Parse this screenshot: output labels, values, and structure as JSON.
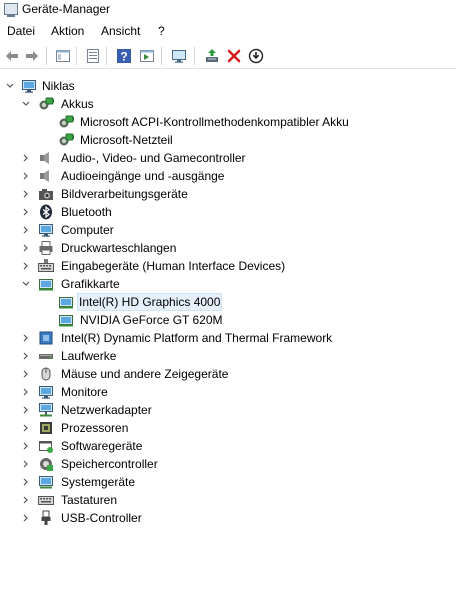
{
  "window": {
    "title": "Geräte-Manager",
    "icon": "device-manager-icon"
  },
  "menu": [
    "Datei",
    "Aktion",
    "Ansicht",
    "?"
  ],
  "toolbar": [
    {
      "name": "back-button",
      "icon": "arrow-left-icon"
    },
    {
      "name": "forward-button",
      "icon": "arrow-right-icon"
    },
    {
      "name": "show-hide-console-tree-button",
      "icon": "console-tree-icon"
    },
    {
      "name": "properties-button",
      "icon": "properties-icon"
    },
    {
      "name": "help-button",
      "icon": "help-icon"
    },
    {
      "name": "action-pane-button",
      "icon": "action-pane-icon"
    },
    {
      "name": "scan-hardware-button",
      "icon": "monitor-scan-icon"
    },
    {
      "name": "update-driver-button",
      "icon": "update-driver-icon"
    },
    {
      "name": "uninstall-device-button",
      "icon": "red-x-icon"
    },
    {
      "name": "disable-device-button",
      "icon": "down-arrow-circle-icon"
    }
  ],
  "tree": {
    "root": {
      "label": "Niklas",
      "icon": "computer-icon"
    },
    "nodes": [
      {
        "label": "Akkus",
        "icon": "battery-icon",
        "expanded": true,
        "children": [
          {
            "label": "Microsoft ACPI-Kontrollmethodenkompatibler Akku",
            "icon": "battery-icon"
          },
          {
            "label": "Microsoft-Netzteil",
            "icon": "battery-icon"
          }
        ]
      },
      {
        "label": "Audio-, Video- und Gamecontroller",
        "icon": "speaker-icon",
        "expanded": false
      },
      {
        "label": "Audioeingänge und -ausgänge",
        "icon": "speaker-icon",
        "expanded": false
      },
      {
        "label": "Bildverarbeitungsgeräte",
        "icon": "camera-icon",
        "expanded": false
      },
      {
        "label": "Bluetooth",
        "icon": "bluetooth-icon",
        "expanded": false
      },
      {
        "label": "Computer",
        "icon": "computer-monitor-icon",
        "expanded": false
      },
      {
        "label": "Druckwarteschlangen",
        "icon": "printer-icon",
        "expanded": false
      },
      {
        "label": "Eingabegeräte (Human Interface Devices)",
        "icon": "keyboard-hid-icon",
        "expanded": false
      },
      {
        "label": "Grafikkarte",
        "icon": "display-adapter-icon",
        "expanded": true,
        "children": [
          {
            "label": "Intel(R) HD Graphics 4000",
            "icon": "display-adapter-icon",
            "selected": true
          },
          {
            "label": "NVIDIA GeForce GT 620M",
            "icon": "display-adapter-icon"
          }
        ]
      },
      {
        "label": "Intel(R) Dynamic Platform and Thermal Framework",
        "icon": "chip-icon",
        "expanded": false
      },
      {
        "label": "Laufwerke",
        "icon": "drive-icon",
        "expanded": false
      },
      {
        "label": "Mäuse und andere Zeigegeräte",
        "icon": "mouse-icon",
        "expanded": false
      },
      {
        "label": "Monitore",
        "icon": "monitor-icon",
        "expanded": false
      },
      {
        "label": "Netzwerkadapter",
        "icon": "network-icon",
        "expanded": false
      },
      {
        "label": "Prozessoren",
        "icon": "processor-icon",
        "expanded": false
      },
      {
        "label": "Softwaregeräte",
        "icon": "software-device-icon",
        "expanded": false
      },
      {
        "label": "Speichercontroller",
        "icon": "storage-controller-icon",
        "expanded": false
      },
      {
        "label": "Systemgeräte",
        "icon": "system-device-icon",
        "expanded": false
      },
      {
        "label": "Tastaturen",
        "icon": "keyboard-icon",
        "expanded": false
      },
      {
        "label": "USB-Controller",
        "icon": "usb-icon",
        "expanded": false
      }
    ]
  },
  "colors": {
    "selection": "#e5f0fb",
    "selection_border": "#cde4f7",
    "uninstall_red": "#d11a1a"
  }
}
